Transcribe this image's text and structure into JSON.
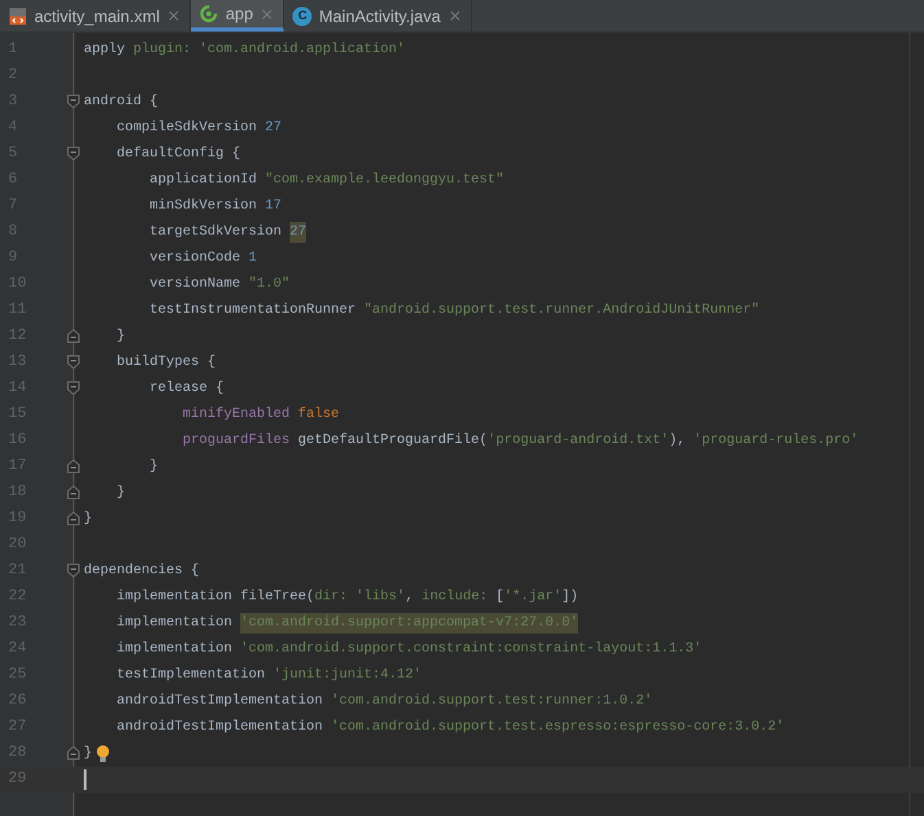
{
  "tabs": [
    {
      "label": "activity_main.xml",
      "kind": "xml",
      "selected": false
    },
    {
      "label": "app",
      "kind": "gradle",
      "selected": true
    },
    {
      "label": "MainActivity.java",
      "kind": "class",
      "icon_text": "C",
      "selected": false
    }
  ],
  "lines": [
    {
      "n": "1",
      "tokens": [
        {
          "t": "apply ",
          "kind": "plain"
        },
        {
          "t": "plugin: ",
          "kind": "arg"
        },
        {
          "t": "'com.android.application'",
          "kind": "string"
        }
      ]
    },
    {
      "n": "2"
    },
    {
      "n": "3",
      "fold_start": true,
      "tokens": [
        {
          "t": "android {",
          "kind": "plain"
        }
      ]
    },
    {
      "n": "4",
      "tokens": [
        {
          "t": "    compileSdkVersion ",
          "kind": "plain"
        },
        {
          "t": "27",
          "kind": "number"
        }
      ]
    },
    {
      "n": "5",
      "fold_start": true,
      "tokens": [
        {
          "t": "    defaultConfig {",
          "kind": "plain"
        }
      ]
    },
    {
      "n": "6",
      "tokens": [
        {
          "t": "        applicationId ",
          "kind": "plain"
        },
        {
          "t": "\"com.example.leedonggyu.test\"",
          "kind": "string"
        }
      ]
    },
    {
      "n": "7",
      "tokens": [
        {
          "t": "        minSdkVersion ",
          "kind": "plain"
        },
        {
          "t": "17",
          "kind": "number"
        }
      ]
    },
    {
      "n": "8",
      "tokens": [
        {
          "t": "        targetSdkVersion ",
          "kind": "plain"
        },
        {
          "t": "27",
          "kind": "marked"
        }
      ]
    },
    {
      "n": "9",
      "tokens": [
        {
          "t": "        versionCode ",
          "kind": "plain"
        },
        {
          "t": "1",
          "kind": "number"
        }
      ]
    },
    {
      "n": "10",
      "tokens": [
        {
          "t": "        versionName ",
          "kind": "plain"
        },
        {
          "t": "\"1.0\"",
          "kind": "string"
        }
      ]
    },
    {
      "n": "11",
      "tokens": [
        {
          "t": "        testInstrumentationRunner ",
          "kind": "plain"
        },
        {
          "t": "\"android.support.test.runner.AndroidJUnitRunner\"",
          "kind": "string"
        }
      ]
    },
    {
      "n": "12",
      "fold_end": true,
      "tokens": [
        {
          "t": "    }",
          "kind": "plain"
        }
      ]
    },
    {
      "n": "13",
      "fold_start": true,
      "tokens": [
        {
          "t": "    buildTypes {",
          "kind": "plain"
        }
      ]
    },
    {
      "n": "14",
      "fold_start": true,
      "tokens": [
        {
          "t": "        release {",
          "kind": "plain"
        }
      ]
    },
    {
      "n": "15",
      "tokens": [
        {
          "t": "            minifyEnabled ",
          "kind": "property"
        },
        {
          "t": "false",
          "kind": "keyword"
        }
      ]
    },
    {
      "n": "16",
      "tokens": [
        {
          "t": "            proguardFiles ",
          "kind": "property"
        },
        {
          "t": "getDefaultProguardFile(",
          "kind": "plain"
        },
        {
          "t": "'proguard-android.txt'",
          "kind": "string"
        },
        {
          "t": "), ",
          "kind": "plain"
        },
        {
          "t": "'proguard-rules.pro'",
          "kind": "string"
        }
      ]
    },
    {
      "n": "17",
      "fold_end": true,
      "tokens": [
        {
          "t": "        }",
          "kind": "plain"
        }
      ]
    },
    {
      "n": "18",
      "fold_end": true,
      "tokens": [
        {
          "t": "    }",
          "kind": "plain"
        }
      ]
    },
    {
      "n": "19",
      "fold_end": true,
      "tokens": [
        {
          "t": "}",
          "kind": "plain"
        }
      ]
    },
    {
      "n": "20"
    },
    {
      "n": "21",
      "fold_start": true,
      "tokens": [
        {
          "t": "dependencies {",
          "kind": "plain"
        }
      ]
    },
    {
      "n": "22",
      "tokens": [
        {
          "t": "    implementation fileTree(",
          "kind": "plain"
        },
        {
          "t": "dir: ",
          "kind": "arg"
        },
        {
          "t": "'libs'",
          "kind": "string"
        },
        {
          "t": ", ",
          "kind": "plain"
        },
        {
          "t": "include: ",
          "kind": "arg"
        },
        {
          "t": "[",
          "kind": "plain"
        },
        {
          "t": "'*.jar'",
          "kind": "string"
        },
        {
          "t": "])",
          "kind": "plain"
        }
      ]
    },
    {
      "n": "23",
      "tokens": [
        {
          "t": "    implementation ",
          "kind": "plain"
        },
        {
          "t": "'com.android.support:appcompat-v7:27.0.0'",
          "kind": "warning"
        }
      ]
    },
    {
      "n": "24",
      "tokens": [
        {
          "t": "    implementation ",
          "kind": "plain"
        },
        {
          "t": "'com.android.support.constraint:constraint-layout:1.1.3'",
          "kind": "string"
        }
      ]
    },
    {
      "n": "25",
      "tokens": [
        {
          "t": "    testImplementation ",
          "kind": "plain"
        },
        {
          "t": "'junit:junit:4.12'",
          "kind": "string"
        }
      ]
    },
    {
      "n": "26",
      "tokens": [
        {
          "t": "    androidTestImplementation ",
          "kind": "plain"
        },
        {
          "t": "'com.android.support.test:runner:1.0.2'",
          "kind": "string"
        }
      ]
    },
    {
      "n": "27",
      "tokens": [
        {
          "t": "    androidTestImplementation ",
          "kind": "plain"
        },
        {
          "t": "'com.android.support.test.espresso:espresso-core:3.0.2'",
          "kind": "string"
        }
      ]
    },
    {
      "n": "28",
      "fold_end": true,
      "bulb": true,
      "tokens": [
        {
          "t": "}",
          "kind": "plain"
        }
      ]
    },
    {
      "n": "29",
      "current": true
    }
  ]
}
